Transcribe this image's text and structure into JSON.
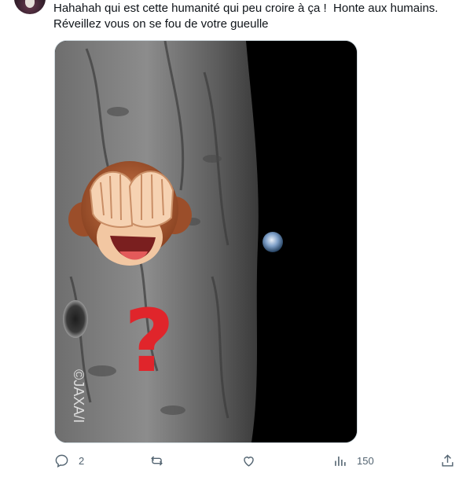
{
  "tweet": {
    "text": "Hahahah qui est cette humanité qui peu croire à ça !  Honte aux humains.\nRéveillez vous on se fou de votre gueulle",
    "media": {
      "watermark": "©JAXA/I",
      "emojis": [
        "see-no-evil-monkey",
        "red-question-mark"
      ]
    }
  },
  "actions": {
    "reply_count": "2",
    "retweet_count": "",
    "like_count": "",
    "views_count": "150"
  },
  "colors": {
    "text": "#0f1419",
    "muted": "#536471",
    "border": "#cfd9de"
  },
  "icons": [
    "reply-icon",
    "retweet-icon",
    "like-icon",
    "views-icon",
    "share-icon"
  ]
}
